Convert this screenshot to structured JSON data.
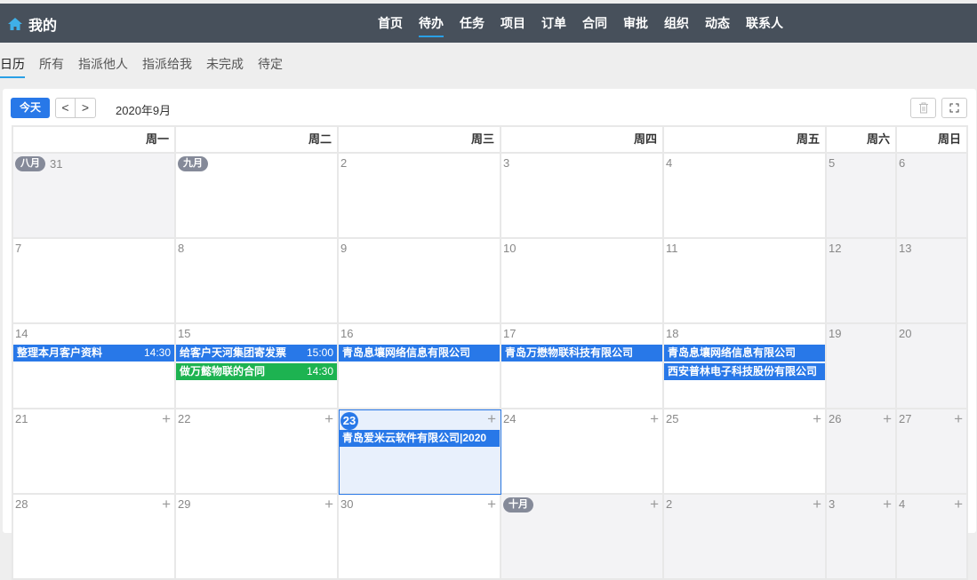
{
  "topbar": {
    "title": "我的",
    "nav": [
      "首页",
      "待办",
      "任务",
      "项目",
      "订单",
      "合同",
      "审批",
      "组织",
      "动态",
      "联系人"
    ],
    "active_nav": 1
  },
  "subtabs": {
    "items": [
      "日历",
      "所有",
      "指派他人",
      "指派给我",
      "未完成",
      "待定"
    ],
    "active": 0
  },
  "toolbar": {
    "today": "今天",
    "prev": "<",
    "next": ">",
    "month": "2020年9月"
  },
  "weekdays": [
    "周一",
    "周二",
    "周三",
    "周四",
    "周五",
    "周六",
    "周日"
  ],
  "colors": {
    "blue": "#2878e8",
    "green": "#1db351"
  },
  "weeks": [
    {
      "plus": false,
      "days": [
        {
          "d": "31",
          "badge": "八月",
          "grey": true
        },
        {
          "d": "",
          "badge": "九月"
        },
        {
          "d": "2"
        },
        {
          "d": "3"
        },
        {
          "d": "4"
        },
        {
          "d": "5",
          "grey": true
        },
        {
          "d": "6",
          "grey": true
        }
      ]
    },
    {
      "plus": false,
      "days": [
        {
          "d": "7"
        },
        {
          "d": "8"
        },
        {
          "d": "9"
        },
        {
          "d": "10"
        },
        {
          "d": "11"
        },
        {
          "d": "12",
          "grey": true
        },
        {
          "d": "13",
          "grey": true
        }
      ]
    },
    {
      "plus": false,
      "days": [
        {
          "d": "14",
          "events": [
            {
              "title": "整理本月客户资料",
              "time": "14:30",
              "color": "blue"
            }
          ]
        },
        {
          "d": "15",
          "events": [
            {
              "title": "给客户天河集团寄发票",
              "time": "15:00",
              "color": "blue"
            },
            {
              "title": "做万懿物联的合同",
              "time": "14:30",
              "color": "green"
            }
          ]
        },
        {
          "d": "16",
          "events": [
            {
              "title": "青岛息壤网络信息有限公司",
              "color": "blue"
            }
          ]
        },
        {
          "d": "17",
          "events": [
            {
              "title": "青岛万懋物联科技有限公司",
              "color": "blue"
            }
          ]
        },
        {
          "d": "18",
          "events": [
            {
              "title": "青岛息壤网络信息有限公司",
              "color": "blue"
            },
            {
              "title": "西安普林电子科技股份有限公司",
              "color": "blue"
            }
          ]
        },
        {
          "d": "19",
          "grey": true
        },
        {
          "d": "20",
          "grey": true
        }
      ]
    },
    {
      "plus": true,
      "days": [
        {
          "d": "21"
        },
        {
          "d": "22"
        },
        {
          "d": "23",
          "today": true,
          "events": [
            {
              "title": "青岛爱米云软件有限公司|2020",
              "color": "blue"
            }
          ]
        },
        {
          "d": "24"
        },
        {
          "d": "25"
        },
        {
          "d": "26",
          "grey": true
        },
        {
          "d": "27",
          "grey": true
        }
      ]
    },
    {
      "plus": true,
      "days": [
        {
          "d": "28"
        },
        {
          "d": "29"
        },
        {
          "d": "30"
        },
        {
          "d": "",
          "badge": "十月",
          "grey": true
        },
        {
          "d": "2",
          "grey": true
        },
        {
          "d": "3",
          "grey": true
        },
        {
          "d": "4",
          "grey": true
        }
      ]
    }
  ]
}
